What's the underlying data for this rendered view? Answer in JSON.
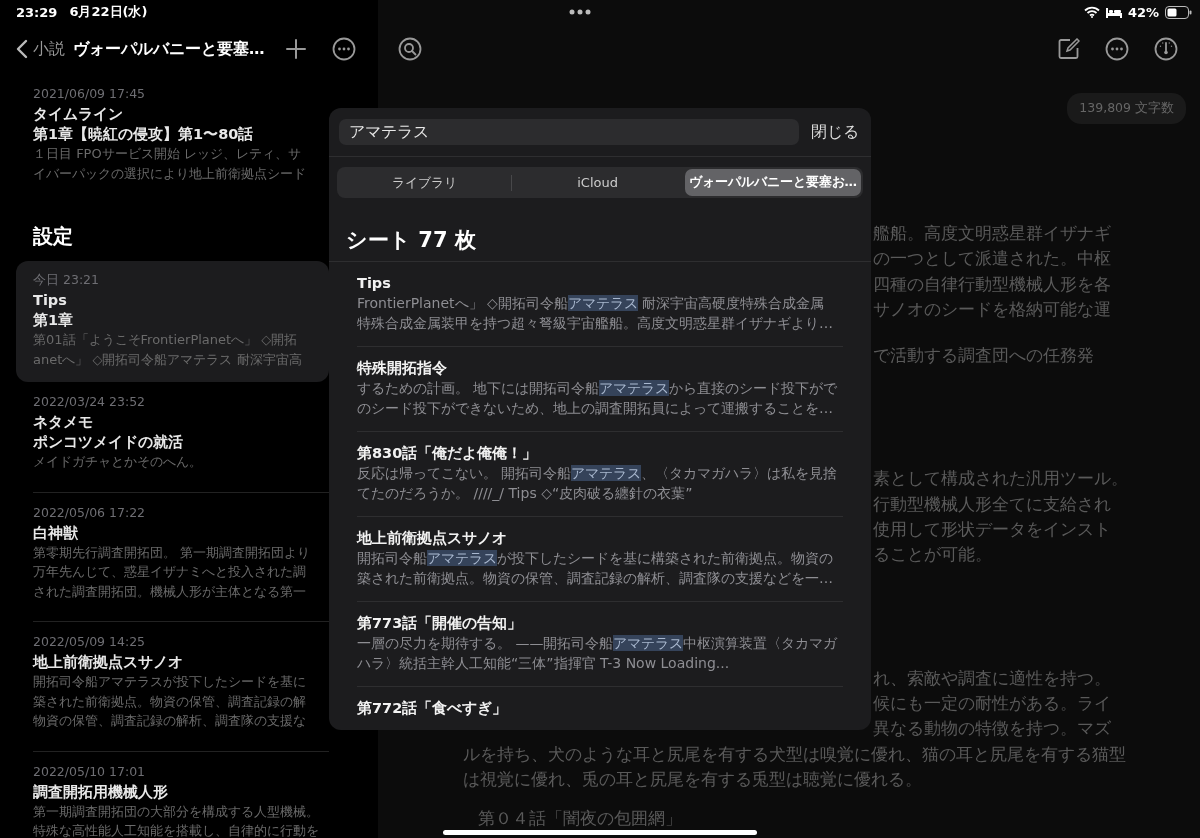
{
  "status_bar": {
    "time": "23:29",
    "date": "6月22日(水)",
    "battery": "42%"
  },
  "sidebar": {
    "back_label": "小説",
    "title": "ヴォーパルバニーと要塞…",
    "groups": [
      {
        "entries": [
          {
            "date": "2021/06/09 17:45",
            "title": "タイムライン",
            "subtitle": "第1章【暁紅の侵攻】第1〜80話",
            "selected": false,
            "preview": [
              "１日目 FPOサービス開始 レッジ、レティ、サ",
              "イバーパックの選択により地上前衛拠点シード"
            ]
          }
        ]
      },
      {
        "heading": "設定",
        "entries": [
          {
            "date": "今日 23:21",
            "title": "Tips",
            "subtitle": "第1章",
            "selected": true,
            "preview": [
              "第01話「ようこそFrontierPlanetへ」 ◇開拓",
              "anetへ」 ◇開拓司令船アマテラス 耐深宇宙高"
            ]
          },
          {
            "date": "2022/03/24 23:52",
            "title": "ネタメモ",
            "subtitle": "ポンコツメイドの就活",
            "selected": false,
            "preview": [
              "メイドガチャとかそのへん。"
            ]
          },
          {
            "date": "2022/05/06 17:22",
            "title": "白神獣",
            "selected": false,
            "preview": [
              "第零期先行調査開拓団。 第一期調査開拓団より",
              "万年先んじて、惑星イザナミへと投入された調",
              "された調査開拓団。機械人形が主体となる第一"
            ]
          },
          {
            "date": "2022/05/09 14:25",
            "title": "地上前衛拠点スサノオ",
            "selected": false,
            "preview": [
              "開拓司令船アマテラスが投下したシードを基に",
              "築された前衛拠点。物資の保管、調査記録の解",
              "物資の保管、調査記録の解析、調査隊の支援な"
            ]
          },
          {
            "date": "2022/05/10 17:01",
            "title": "調査開拓用機械人形",
            "selected": false,
            "preview": [
              "第一期調査開拓団の大部分を構成する人型機械。",
              "特殊な高性能人工知能を搭載し、自律的に行動を"
            ]
          }
        ]
      }
    ]
  },
  "editor": {
    "word_count": "139,809 文字数",
    "blocks": [
      {
        "kind": "para",
        "lines": [
          {
            "kind": "fragment",
            "text": "艦船。高度文明惑星群イザナギ"
          },
          {
            "kind": "fragment",
            "text": "の一つとして派遣された。中枢"
          },
          {
            "kind": "fragment",
            "text": "四種の自律行動型機械人形を各"
          },
          {
            "kind": "fragment",
            "text": "サノオのシードを格納可能な運"
          }
        ]
      },
      {
        "kind": "para",
        "lines": [
          {
            "kind": "fragment",
            "text": "で活動する調査団への任務発"
          }
        ]
      },
      {
        "kind": "section",
        "lines": [
          {
            "kind": "fragment",
            "text": "素として構成された汎用ツール。"
          },
          {
            "kind": "fragment",
            "text": "行動型機械人形全てに支給され"
          },
          {
            "kind": "fragment",
            "text": "使用して形状データをインスト"
          },
          {
            "kind": "fragment",
            "text": "ることが可能。"
          }
        ]
      },
      {
        "kind": "section",
        "lines": [
          {
            "kind": "fragment",
            "text": "れ、索敵や調査に適性を持つ。"
          },
          {
            "kind": "fragment",
            "text": "候にも一定の耐性がある。ライ"
          },
          {
            "kind": "fragment",
            "text": "異なる動物の特徴を持つ。マズ"
          },
          {
            "kind": "full",
            "text": "ルを持ち、犬のような耳と尻尾を有する犬型は嗅覚に優れ、猫の耳と尻尾を有する猫型"
          },
          {
            "kind": "full",
            "text": "は視覚に優れ、兎の耳と尻尾を有する兎型は聴覚に優れる。"
          }
        ]
      },
      {
        "kind": "heading",
        "lines": [
          {
            "kind": "full",
            "text": "第０４話「闇夜の包囲網」"
          }
        ]
      }
    ]
  },
  "search": {
    "value": "アマテラス",
    "close": "閉じる",
    "scopes": [
      {
        "label": "ライブラリ",
        "selected": false
      },
      {
        "label": "iCloud",
        "selected": false
      },
      {
        "label": "ヴォーパルバニーと要塞お…",
        "selected": true
      }
    ],
    "heading": "シート 77 枚",
    "results": [
      {
        "title": "Tips",
        "lines": [
          [
            {
              "text": "FrontierPlanetへ」 ◇開拓司令船",
              "highlight": false
            },
            {
              "text": "アマテラス",
              "highlight": true
            },
            {
              "text": " 耐深宇宙高硬度特殊合成金属",
              "highlight": false
            }
          ],
          [
            {
              "text": "特殊合成金属装甲を持つ超々弩級宇宙艦船。高度文明惑星群イザナギより…",
              "highlight": false
            }
          ]
        ]
      },
      {
        "title": "特殊開拓指令",
        "lines": [
          [
            {
              "text": "するための計画。 地下には開拓司令船",
              "highlight": false
            },
            {
              "text": "アマテラス",
              "highlight": true
            },
            {
              "text": "から直接のシード投下がで",
              "highlight": false
            }
          ],
          [
            {
              "text": "のシード投下ができないため、地上の調査開拓員によって運搬することを…",
              "highlight": false
            }
          ]
        ]
      },
      {
        "title": "第830話「俺だよ俺俺！」",
        "lines": [
          [
            {
              "text": "反応は帰ってこない。 開拓司令船",
              "highlight": false
            },
            {
              "text": "アマテラス",
              "highlight": true
            },
            {
              "text": "、〈タカマガハラ〉は私を見捨",
              "highlight": false
            }
          ],
          [
            {
              "text": "てたのだろうか。 ////_/ Tips ◇“皮肉破る纏針の衣葉”",
              "highlight": false
            }
          ]
        ]
      },
      {
        "title": "地上前衛拠点スサノオ",
        "lines": [
          [
            {
              "text": "開拓司令船",
              "highlight": false
            },
            {
              "text": "アマテラス",
              "highlight": true
            },
            {
              "text": "が投下したシードを基に構築された前衛拠点。物資の",
              "highlight": false
            }
          ],
          [
            {
              "text": "築された前衛拠点。物資の保管、調査記録の解析、調査隊の支援などを一…",
              "highlight": false
            }
          ]
        ]
      },
      {
        "title": "第773話「開催の告知」",
        "lines": [
          [
            {
              "text": "一層の尽力を期待する。 ——開拓司令船",
              "highlight": false
            },
            {
              "text": "アマテラス",
              "highlight": true
            },
            {
              "text": "中枢演算装置〈タカマガ",
              "highlight": false
            }
          ],
          [
            {
              "text": "ハラ〉統括主幹人工知能“三体”指揮官 T-3 Now Loading...",
              "highlight": false
            }
          ]
        ]
      },
      {
        "title": "第772話「食べすぎ」"
      }
    ]
  }
}
